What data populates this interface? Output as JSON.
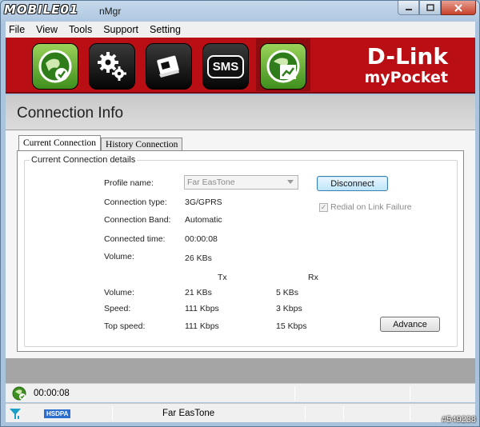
{
  "window": {
    "logo_text": "MOBILE01",
    "title": "nMgr"
  },
  "menu": [
    "File",
    "View",
    "Tools",
    "Support",
    "Setting"
  ],
  "toolbar": {
    "sms_label": "SMS",
    "brand_main": "D-Link",
    "brand_sub": "myPocket",
    "colors": {
      "banner": "#b90f14",
      "active_tool": "#6fb83a"
    }
  },
  "header": {
    "title": "Connection Info"
  },
  "tabs": [
    {
      "label": "Current Connection",
      "active": true
    },
    {
      "label": "History Connection",
      "active": false
    }
  ],
  "details": {
    "legend": "Current Connection details",
    "profile_label": "Profile name:",
    "profile_value": "Far EasTone",
    "connection_type_label": "Connection type:",
    "connection_type_value": "3G/GPRS",
    "connection_band_label": "Connection Band:",
    "connection_band_value": "Automatic",
    "connected_time_label": "Connected time:",
    "connected_time_value": "00:00:08",
    "volume_label": "Volume:",
    "volume_value": "26 KBs",
    "tx_header": "Tx",
    "rx_header": "Rx",
    "rows": [
      {
        "label": "Volume:",
        "tx": "21 KBs",
        "rx": "5 KBs"
      },
      {
        "label": "Speed:",
        "tx": "111 Kbps",
        "rx": "3 Kbps"
      },
      {
        "label": "Top speed:",
        "tx": "111 Kbps",
        "rx": "15 Kbps"
      }
    ],
    "disconnect_button": "Disconnect",
    "redial_label": "Redial on Link Failure",
    "redial_checked": true,
    "advance_button": "Advance"
  },
  "status": {
    "time": "00:00:08",
    "network_badge": "HSDPA",
    "operator": "Far EasTone"
  },
  "watermark": "#549238"
}
